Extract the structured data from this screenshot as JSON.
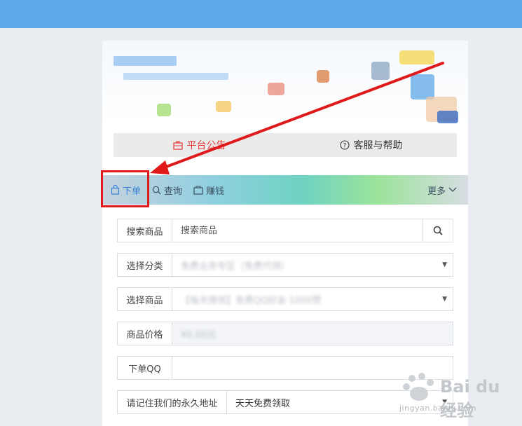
{
  "notice": {
    "announcement": "平台公告",
    "help": "客服与帮助"
  },
  "tabs": {
    "order": "下单",
    "query": "查询",
    "earn": "赚钱",
    "more": "更多"
  },
  "form": {
    "search_label": "搜索商品",
    "search_placeholder": "搜索商品",
    "category_label": "选择分类",
    "category_value": "免费业务专区（免费代领）",
    "product_label": "选择商品",
    "product_value": "【每天限领】免费QQ好友·1000赞",
    "price_label": "商品价格",
    "price_value": "¥0.00元",
    "qq_label": "下单QQ",
    "qq_value": "",
    "address_label": "请记住我们的永久地址",
    "address_value": "天天免费领取"
  },
  "watermark": {
    "brand": "Bai du 经验",
    "url": "jingyan.baidu.com"
  },
  "colors": {
    "topbar": "#5ea9e8",
    "annotation_red": "#e0191b",
    "active_tab": "#3a7fd8",
    "notice_red": "#e63b3b"
  }
}
